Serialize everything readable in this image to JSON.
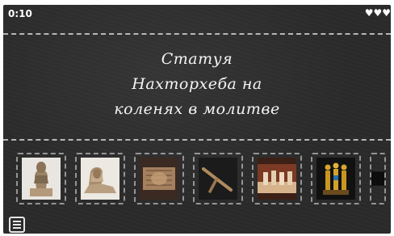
{
  "hud": {
    "timer": "0:10",
    "lives": 3
  },
  "title": {
    "line1": "Статуя",
    "line2": "Нахторхеба на",
    "line3": "коленях в молитве"
  },
  "cards": [
    {
      "subject": "kneeling statue"
    },
    {
      "subject": "sphinx"
    },
    {
      "subject": "carved relief"
    },
    {
      "subject": "wooden tool"
    },
    {
      "subject": "statue figurines in display"
    },
    {
      "subject": "golden triad figurines"
    },
    {
      "subject": "partially visible image"
    }
  ],
  "icons": {
    "heart": "heart-icon",
    "menu": "menu-icon"
  },
  "colors": {
    "board": "#2a2a2a",
    "chalk": "#f4f4f4"
  }
}
